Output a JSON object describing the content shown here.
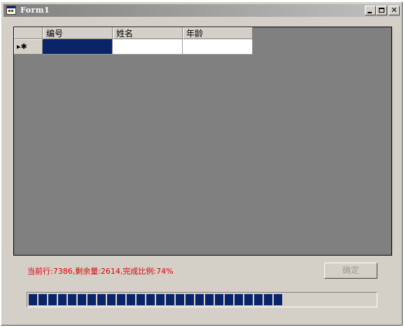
{
  "window": {
    "title": "Form1",
    "minimize_glyph": "",
    "maximize_glyph": "",
    "close_glyph": "✕"
  },
  "grid": {
    "columns": [
      "编号",
      "姓名",
      "年龄"
    ],
    "new_row_indicator": "▸✱",
    "rows": [
      {
        "cells": [
          "",
          "",
          ""
        ]
      }
    ]
  },
  "status": {
    "text": "当前行:7386,剩余量:2614,完成比例:74%"
  },
  "ok_button": {
    "label": "确定"
  },
  "progress": {
    "percent": 74
  },
  "colors": {
    "selection": "#0a246a",
    "status_text": "#e00000",
    "grid_background": "#808080"
  }
}
